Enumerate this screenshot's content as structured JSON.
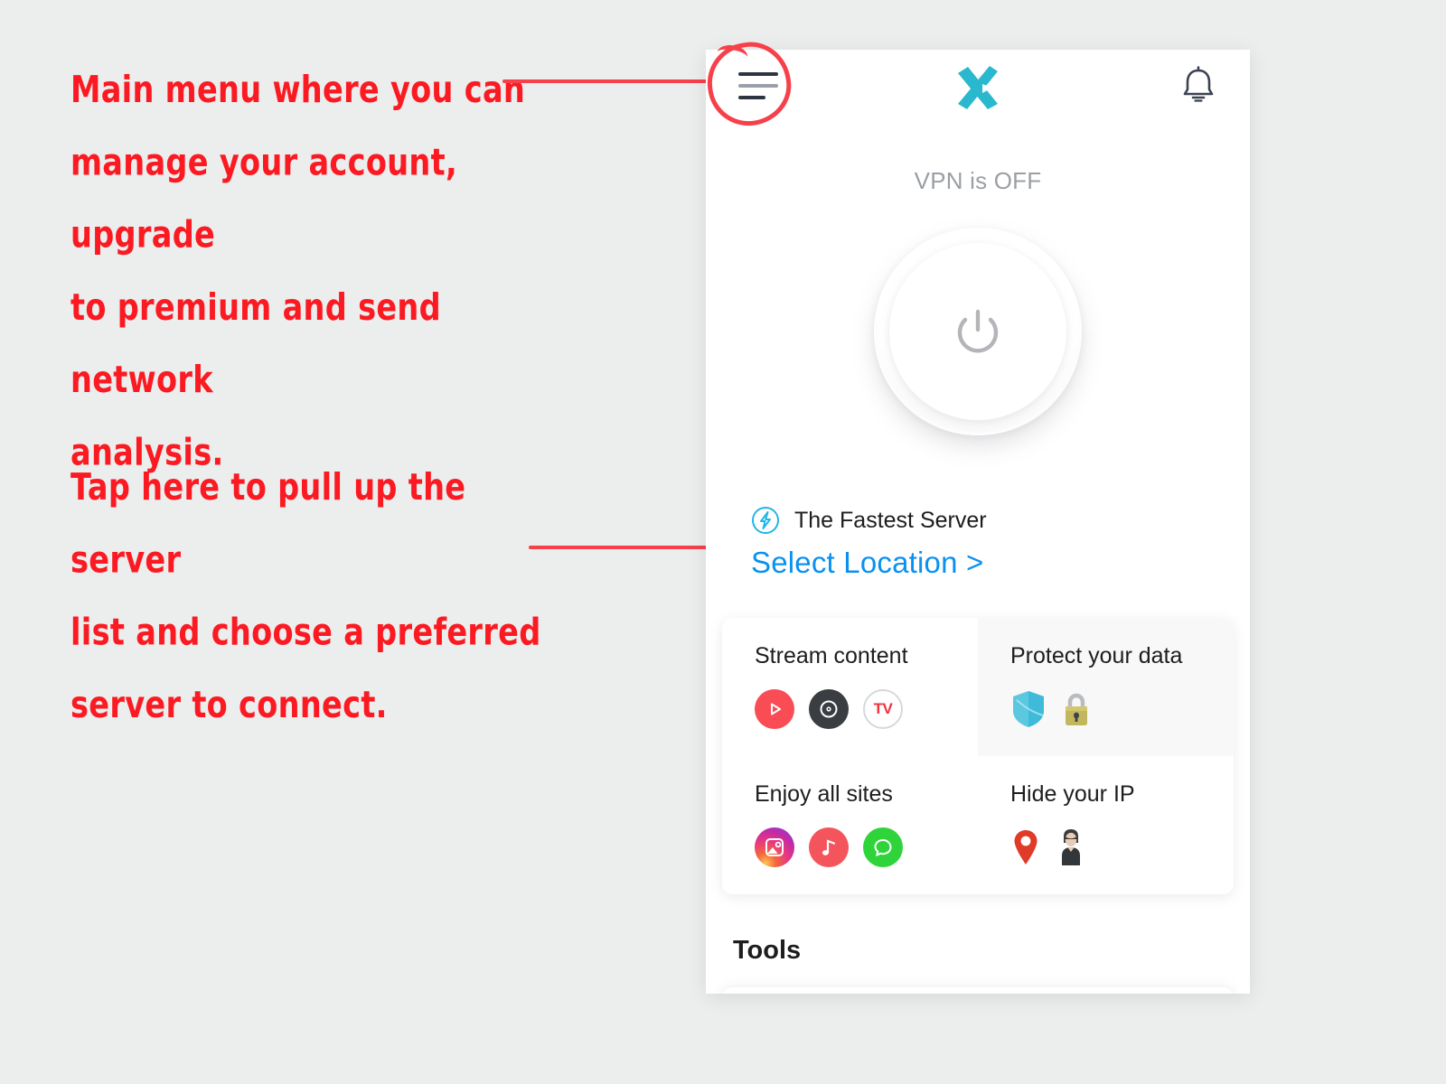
{
  "annotations": [
    {
      "id": "menu-annotation",
      "text": "Main menu where you can\nmanage your account, upgrade\nto premium and send network\nanalysis.",
      "color": "#fb1a22"
    },
    {
      "id": "server-annotation",
      "text": "Tap here to pull up the server\nlist and choose a preferred\nserver to connect.",
      "color": "#fb1a22"
    }
  ],
  "app": {
    "header": {
      "menu_icon": "hamburger-menu-icon",
      "logo_icon": "x-vpn-logo",
      "logo_color": "#29b8ce",
      "notifications_icon": "bell-icon"
    },
    "status": {
      "text": "VPN is OFF"
    },
    "power_button": {
      "icon": "power-icon",
      "state": "off"
    },
    "server": {
      "badge_icon": "lightning-bolt-icon",
      "badge_color": "#22b6e8",
      "name": "The Fastest Server",
      "select_link": "Select Location >",
      "link_color": "#0a91f0"
    },
    "features": [
      {
        "title": "Stream content",
        "tinted": false,
        "icons": [
          {
            "name": "youtube-icon",
            "glyph": "play",
            "class": "ic-youtube"
          },
          {
            "name": "disc-media-icon",
            "glyph": "disc",
            "class": "ic-disc"
          },
          {
            "name": "tv-icon",
            "label": "TV",
            "class": "ic-tv"
          }
        ]
      },
      {
        "title": "Protect your data",
        "tinted": true,
        "icons": [
          {
            "name": "shield-icon",
            "glyph": "shield"
          },
          {
            "name": "lock-icon",
            "glyph": "lock"
          }
        ]
      },
      {
        "title": "Enjoy all sites",
        "tinted": false,
        "icons": [
          {
            "name": "instagram-icon",
            "glyph": "photo",
            "class": "ic-insta"
          },
          {
            "name": "music-note-icon",
            "glyph": "note",
            "class": "ic-music"
          },
          {
            "name": "whatsapp-icon",
            "glyph": "chat",
            "class": "ic-whatsapp"
          }
        ]
      },
      {
        "title": "Hide your IP",
        "tinted": false,
        "icons": [
          {
            "name": "location-pin-icon",
            "glyph": "pin"
          },
          {
            "name": "person-incognito-icon",
            "glyph": "person"
          }
        ]
      }
    ],
    "tools": {
      "title": "Tools"
    }
  }
}
